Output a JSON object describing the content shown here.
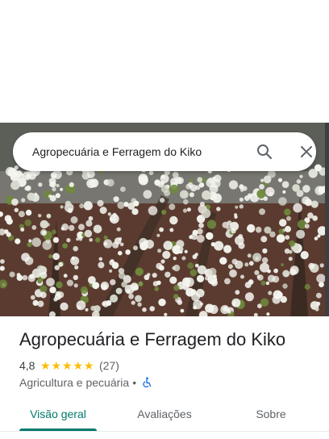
{
  "search": {
    "value": "Agropecuária e Ferragem do Kiko"
  },
  "place": {
    "title": "Agropecuária e Ferragem do Kiko",
    "rating": "4,8",
    "stars_filled": 5,
    "review_count": "(27)",
    "category": "Agricultura e pecuária",
    "separator": "•"
  },
  "tabs": [
    {
      "label": "Visão geral",
      "active": true
    },
    {
      "label": "Avaliações",
      "active": false
    },
    {
      "label": "Sobre",
      "active": false
    }
  ],
  "colors": {
    "accent": "#00796b",
    "star": "#fbbc04",
    "accessibility_icon": "#1a73e8"
  },
  "icons": {
    "search": "search-icon",
    "close": "close-icon",
    "wheelchair": "wheelchair-icon",
    "star": "star-icon"
  }
}
